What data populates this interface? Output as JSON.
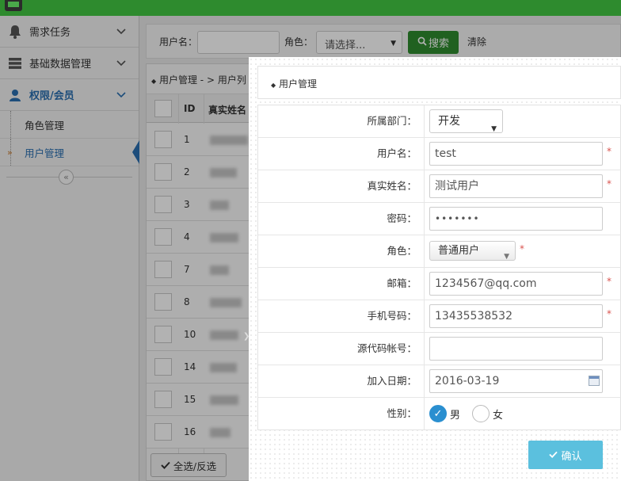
{
  "sidebar": {
    "items": [
      {
        "label": "需求任务",
        "icon": "bell-icon"
      },
      {
        "label": "基础数据管理",
        "icon": "server-icon"
      },
      {
        "label": "权限/会员",
        "icon": "user-icon"
      }
    ],
    "subitems": [
      {
        "label": "角色管理"
      },
      {
        "label": "用户管理"
      }
    ]
  },
  "search": {
    "username_label": "用户名：",
    "username_value": "",
    "role_label": "角色：",
    "role_selected": "请选择...",
    "search_button": "搜索",
    "clear_button": "清除"
  },
  "table": {
    "breadcrumb": "用户管理  - > 用户列",
    "columns": [
      "ID",
      "真实姓名"
    ],
    "ids": [
      "1",
      "2",
      "3",
      "4",
      "7",
      "8",
      "10",
      "14",
      "15",
      "16"
    ],
    "select_all_button": "全选/反选"
  },
  "modal": {
    "title": "用户管理",
    "fields": {
      "department": {
        "label": "所属部门：",
        "value": "开发"
      },
      "username": {
        "label": "用户名：",
        "value": "test"
      },
      "realname": {
        "label": "真实姓名：",
        "value": "测试用户"
      },
      "password": {
        "label": "密码：",
        "value": "•••••••"
      },
      "role": {
        "label": "角色：",
        "value": "普通用户"
      },
      "email": {
        "label": "邮箱：",
        "value": "1234567@qq.com"
      },
      "phone": {
        "label": "手机号码：",
        "value": "13435538532"
      },
      "source_account": {
        "label": "源代码帐号：",
        "value": ""
      },
      "join_date": {
        "label": "加入日期：",
        "value": "2016-03-19"
      },
      "gender": {
        "label": "性别：",
        "male": "男",
        "female": "女",
        "selected": "男"
      }
    },
    "required_mark": "*",
    "confirm_button": "确认"
  },
  "colors": {
    "topbar": "#2e8b2e",
    "search_button": "#2e8b2e",
    "accent": "#2a6fb0",
    "radio_checked": "#2a8fd0",
    "confirm_button": "#5bc0de",
    "required": "#d9534f"
  }
}
